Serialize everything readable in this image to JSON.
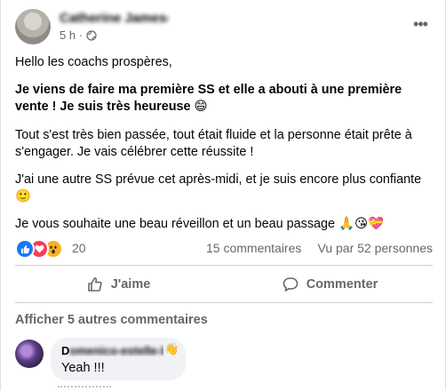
{
  "post": {
    "author_name": "Catherine Jameson",
    "time": "5 h ·",
    "paragraphs": [
      {
        "text": "Hello les coachs prospères,",
        "bold": false
      },
      {
        "text": "Je viens de faire ma première SS et elle a abouti à une première vente ! Je suis très heureuse 😄",
        "bold": true
      },
      {
        "text": "Tout s'est très bien passée, tout était fluide et la personne était prête à s'engager. Je vais célébrer cette réussite !",
        "bold": false
      },
      {
        "text": "J'ai une autre SS prévue cet après-midi, et je suis encore plus confiante 🙂",
        "bold": false
      },
      {
        "text": "Je vous souhaite une beau réveillon et un beau passage 🙏😘💝",
        "bold": false
      }
    ]
  },
  "summary": {
    "reaction_count": "20",
    "comments": "15 commentaires",
    "views": "Vu par 52 personnes"
  },
  "actions": {
    "like_label": "J'aime",
    "comment_label": "Commenter"
  },
  "comments": {
    "more_label": "Afficher 5 autres commentaires",
    "first": {
      "author_initial": "D",
      "author_rest": "omenico-estelle-lacroix",
      "text": "Yeah !!!"
    }
  },
  "colors": {
    "like_blue": "#1877f2",
    "love_red": "#f33e58",
    "wow_yellow": "#f7b125",
    "secondary_text": "#65676b"
  },
  "icons": [
    "globe-icon",
    "more-options-icon",
    "like-reaction-icon",
    "love-reaction-icon",
    "wow-reaction-icon",
    "thumbs-up-icon",
    "comment-icon",
    "wave-icon"
  ]
}
